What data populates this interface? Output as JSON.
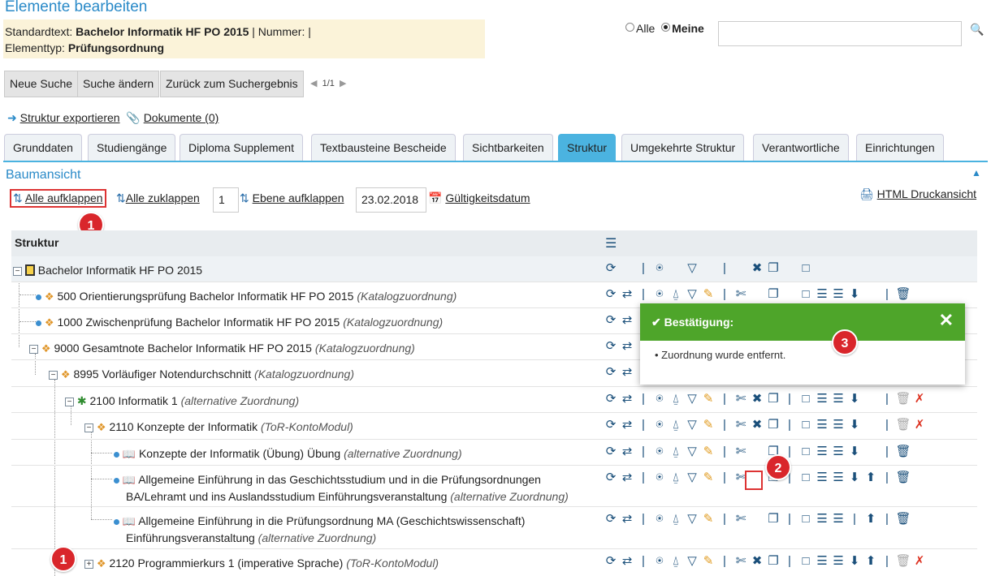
{
  "page_title": "Elemente bearbeiten",
  "info": {
    "standardtext_label": "Standardtext:",
    "standardtext_value": "Bachelor Informatik HF PO 2015",
    "nummer_label": "| Nummer: |",
    "elementtyp_label": "Elementtyp:",
    "elementtyp_value": "Prüfungsordnung"
  },
  "filter": {
    "alle": "Alle",
    "meine": "Meine",
    "selected": "Meine",
    "search_value": ""
  },
  "buttons": {
    "neue_suche": "Neue Suche",
    "suche_aendern": "Suche ändern",
    "zurueck": "Zurück zum Suchergebnis",
    "pager": "1/1"
  },
  "links": {
    "struktur_exportieren": "Struktur exportieren",
    "dokumente": "Dokumente (0)"
  },
  "tabs": [
    "Grunddaten",
    "Studiengänge",
    "Diploma Supplement",
    "Textbausteine Bescheide",
    "Sichtbarkeiten",
    "Struktur",
    "Umgekehrte Struktur",
    "Verantwortliche",
    "Einrichtungen"
  ],
  "active_tab": "Struktur",
  "section_title": "Baumansicht",
  "controls": {
    "alle_aufklappen": "Alle aufklappen",
    "alle_zuklappen": "Alle zuklappen",
    "level": "1",
    "ebene_aufklappen": "Ebene aufklappen",
    "date": "23.02.2018",
    "gueltigkeitsdatum": "Gültigkeitsdatum",
    "html_druck": "HTML Druckansicht"
  },
  "table": {
    "header": "Struktur"
  },
  "rows": [
    {
      "title": "Bachelor Informatik HF PO 2015",
      "note": ""
    },
    {
      "title": "500 Orientierungsprüfung Bachelor Informatik HF PO 2015",
      "note": "(Katalogzuordnung)"
    },
    {
      "title": "1000 Zwischenprüfung Bachelor Informatik HF PO 2015",
      "note": "(Katalogzuordnung)"
    },
    {
      "title": "9000 Gesamtnote Bachelor Informatik HF PO 2015",
      "note": "(Katalogzuordnung)"
    },
    {
      "title": "8995 Vorläufiger Notendurchschnitt",
      "note": "(Katalogzuordnung)"
    },
    {
      "title": "2100 Informatik 1",
      "note": "(alternative Zuordnung)"
    },
    {
      "title": "2110 Konzepte der Informatik",
      "note": "(ToR-KontoModul)"
    },
    {
      "title": "Konzepte der Informatik (Übung) Übung",
      "note": "(alternative Zuordnung)"
    },
    {
      "title": "Allgemeine Einführung in das Geschichtsstudium und in die Prüfungsordnungen",
      "title2": "BA/Lehramt und ins Auslandsstudium Einführungsveranstaltung",
      "note": "(alternative Zuordnung)"
    },
    {
      "title": "Allgemeine Einführung in die Prüfungsordnung MA (Geschichtswissenschaft)",
      "title2": "Einführungsveranstaltung",
      "note": "(alternative Zuordnung)"
    },
    {
      "title": "2120 Programmierkurs 1 (imperative Sprache)",
      "note": "(ToR-KontoModul)"
    }
  ],
  "toast": {
    "title": "Bestätigung:",
    "message": "Zuordnung wurde entfernt.",
    "accent": "#4ea52a"
  },
  "badges": [
    "1",
    "2",
    "3",
    "1"
  ]
}
